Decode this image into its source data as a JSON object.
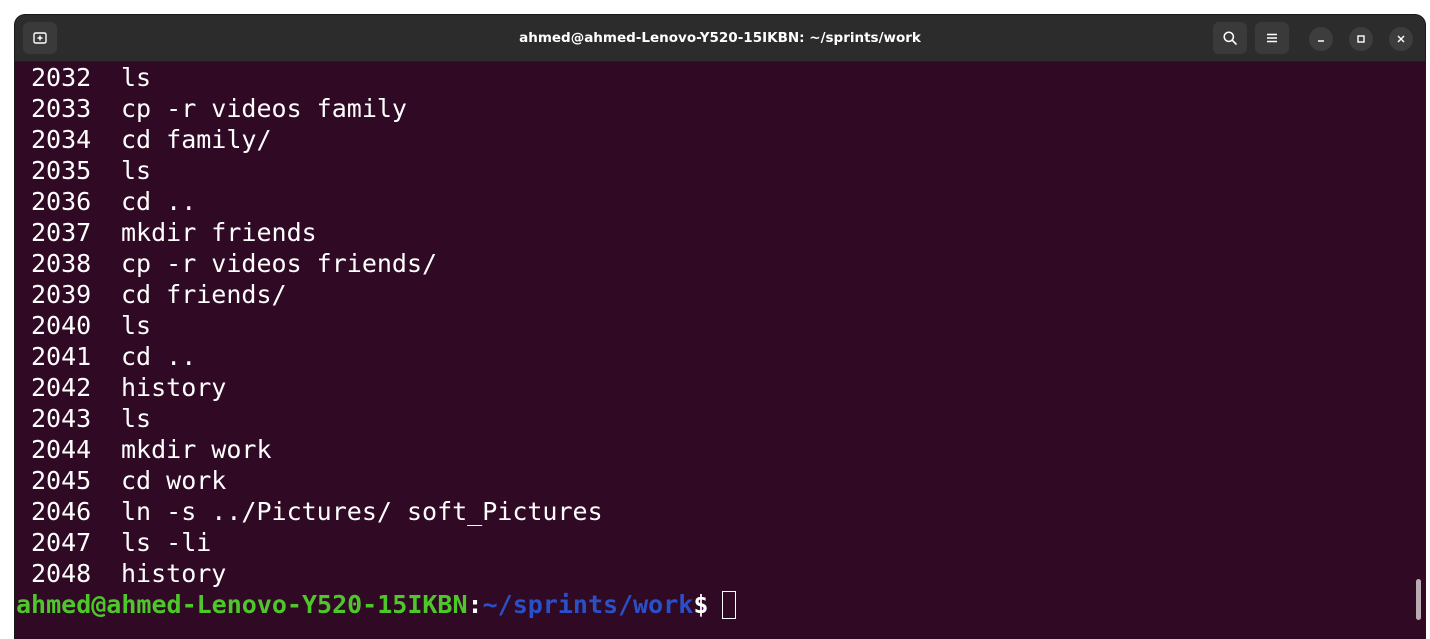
{
  "window": {
    "title": "ahmed@ahmed-Lenovo-Y520-15IKBN: ~/sprints/work"
  },
  "colors": {
    "terminal_bg": "#300a24",
    "titlebar_bg": "#2c2c2c",
    "prompt_user": "#4ec72a",
    "prompt_path": "#2950c8"
  },
  "icons": {
    "new_tab": "new-tab-icon",
    "search": "search-icon",
    "menu": "hamburger-menu-icon",
    "minimize": "minimize-icon",
    "maximize": "maximize-icon",
    "close": "close-icon"
  },
  "history": [
    {
      "num": "2032",
      "cmd": "ls"
    },
    {
      "num": "2033",
      "cmd": "cp -r videos family"
    },
    {
      "num": "2034",
      "cmd": "cd family/"
    },
    {
      "num": "2035",
      "cmd": "ls"
    },
    {
      "num": "2036",
      "cmd": "cd .."
    },
    {
      "num": "2037",
      "cmd": "mkdir friends"
    },
    {
      "num": "2038",
      "cmd": "cp -r videos friends/"
    },
    {
      "num": "2039",
      "cmd": "cd friends/"
    },
    {
      "num": "2040",
      "cmd": "ls"
    },
    {
      "num": "2041",
      "cmd": "cd .."
    },
    {
      "num": "2042",
      "cmd": "history"
    },
    {
      "num": "2043",
      "cmd": "ls"
    },
    {
      "num": "2044",
      "cmd": "mkdir work"
    },
    {
      "num": "2045",
      "cmd": "cd work"
    },
    {
      "num": "2046",
      "cmd": "ln -s ../Pictures/ soft_Pictures"
    },
    {
      "num": "2047",
      "cmd": "ls -li"
    },
    {
      "num": "2048",
      "cmd": "history"
    }
  ],
  "prompt": {
    "user_host": "ahmed@ahmed-Lenovo-Y520-15IKBN",
    "colon": ":",
    "path": "~/sprints/work",
    "symbol": "$"
  }
}
